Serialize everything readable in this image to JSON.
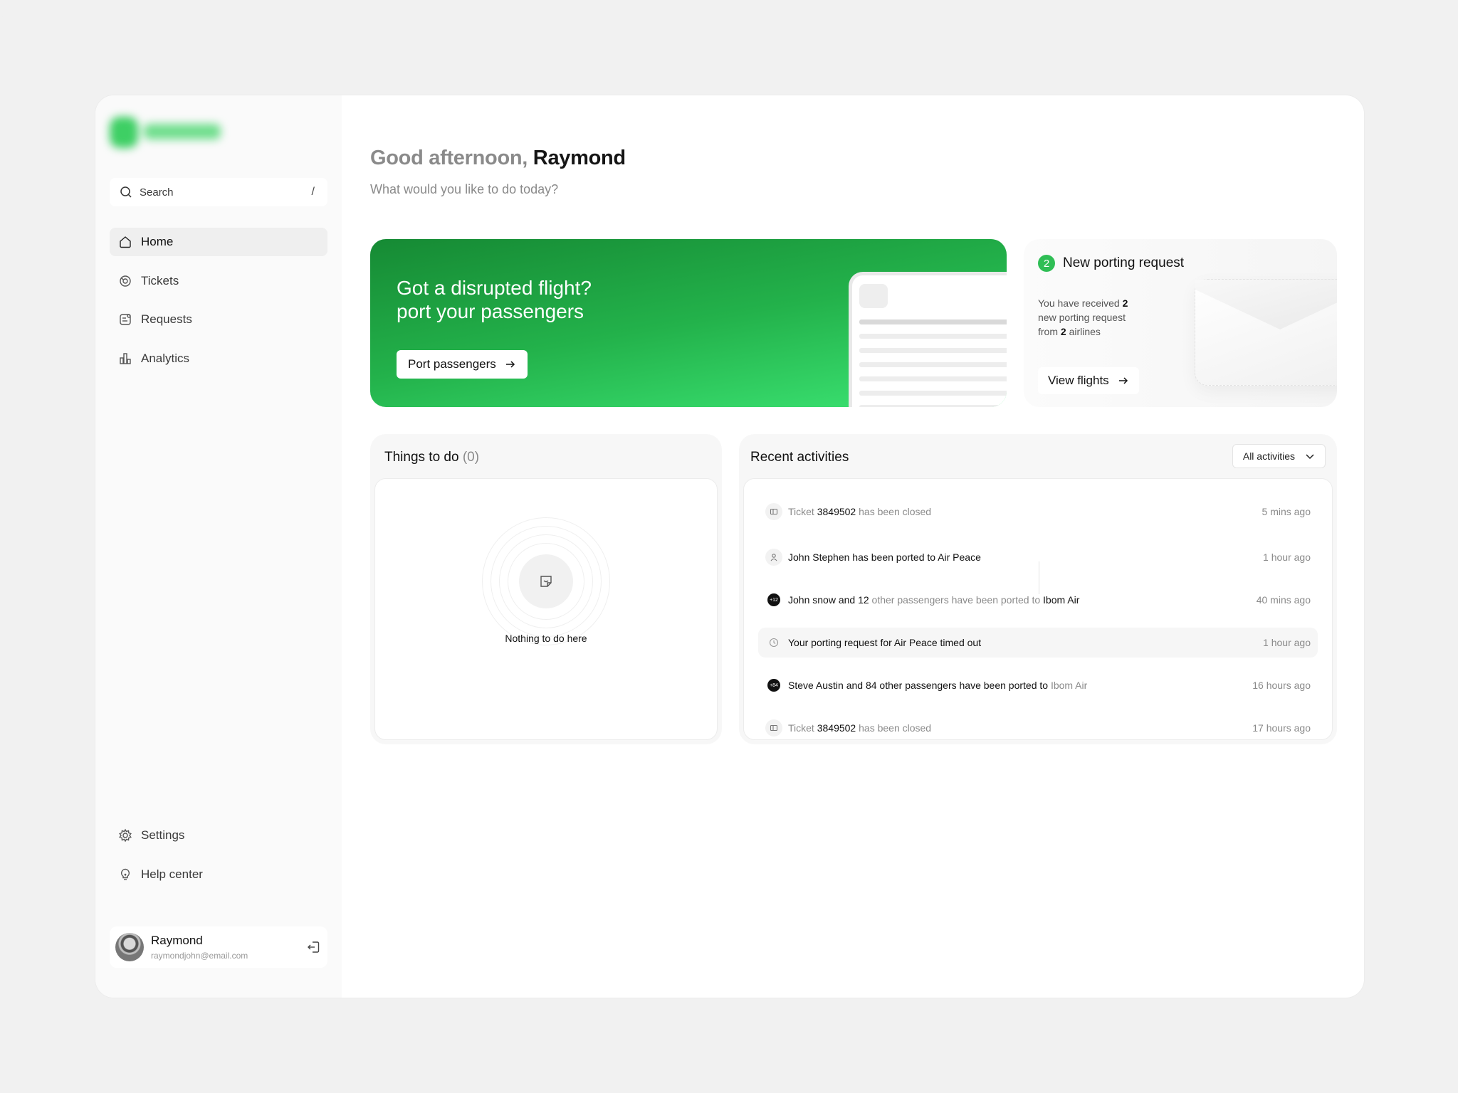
{
  "sidebar": {
    "search": {
      "label": "Search",
      "shortcut": "/"
    },
    "nav": [
      {
        "label": "Home",
        "icon": "home-icon",
        "active": true
      },
      {
        "label": "Tickets",
        "icon": "ticket-icon"
      },
      {
        "label": "Requests",
        "icon": "requests-icon"
      },
      {
        "label": "Analytics",
        "icon": "analytics-icon"
      }
    ],
    "nav_bottom": [
      {
        "label": "Settings",
        "icon": "gear-icon"
      },
      {
        "label": "Help center",
        "icon": "lightbulb-icon"
      }
    ],
    "user": {
      "name": "Raymond",
      "email": "raymondjohn@email.com"
    }
  },
  "main": {
    "greeting": {
      "prefix": "Good afternoon,",
      "name": "Raymond"
    },
    "subtitle": "What would you like to do today?",
    "hero": {
      "line1": "Got a disrupted flight?",
      "line2": "port your passengers",
      "button": "Port passengers"
    },
    "porting": {
      "count": "2",
      "title": "New porting request",
      "desc_1": "You have received",
      "desc_count": "2",
      "desc_2": "new porting request from",
      "desc_airlines": "2",
      "desc_3": "airlines",
      "button": "View flights"
    },
    "todo": {
      "title": "Things to do",
      "count": "(0)",
      "empty": "Nothing to do here"
    },
    "recent": {
      "title": "Recent activities",
      "filter": "All activities",
      "items": [
        {
          "a": "Ticket",
          "b": "3849502",
          "c": "has been closed",
          "time": "5 mins ago"
        },
        {
          "a": "John Stephen has been ported to Air Peace",
          "time": "1 hour ago"
        },
        {
          "badge": "+12",
          "a": "John snow and 12",
          "b": "other passengers have been ported to",
          "c": "Ibom Air",
          "time": "40 mins ago"
        },
        {
          "a": "Your porting request for Air Peace timed out",
          "time": "1 hour ago"
        },
        {
          "badge": "+84",
          "a": "Steve Austin and 84 other passengers have been ported to",
          "b": "Ibom Air",
          "time": "16 hours ago"
        },
        {
          "a": "Ticket",
          "b": "3849502",
          "c": "has been closed",
          "time": "17 hours ago"
        }
      ]
    }
  },
  "colors": {
    "accent": "#2fbe55",
    "hero_start": "#168a34",
    "hero_end": "#3de675"
  }
}
